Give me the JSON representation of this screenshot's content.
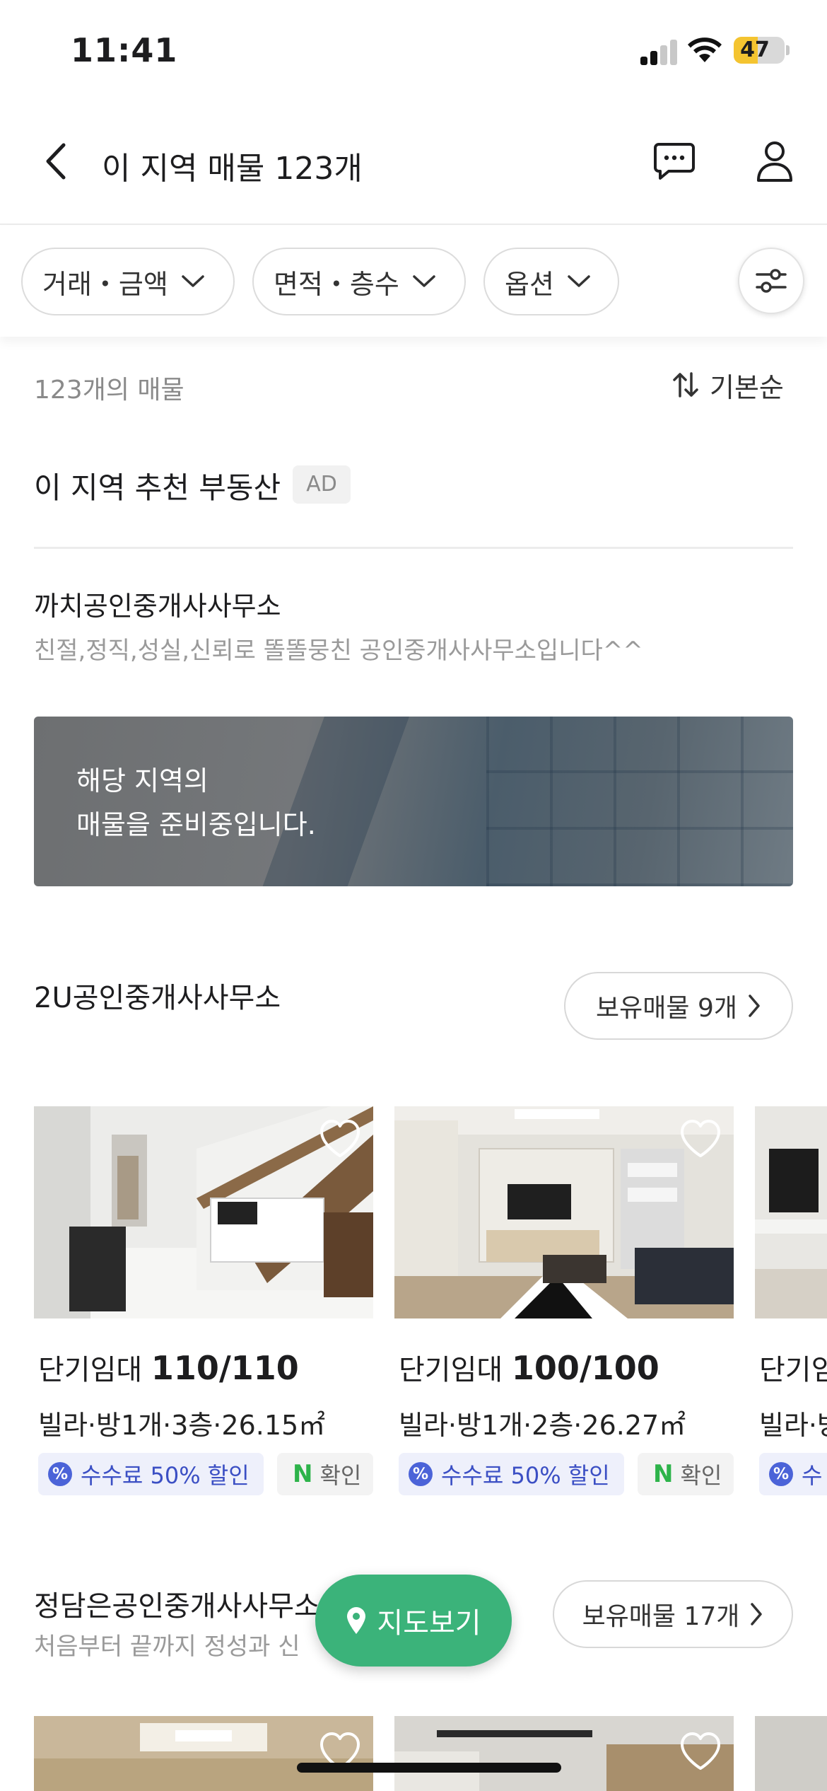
{
  "status_bar": {
    "time": "11:41",
    "battery": "47",
    "battery_level": 0.47
  },
  "header": {
    "title": "이 지역 매물 123개"
  },
  "filters": [
    {
      "label": "거래・금액"
    },
    {
      "label": "면적・층수"
    },
    {
      "label": "옵션"
    }
  ],
  "list": {
    "count_label": "123개의 매물",
    "sort_label": "기본순"
  },
  "recommend": {
    "title": "이 지역 추천 부동산",
    "ad_label": "AD"
  },
  "agency1": {
    "name": "까치공인중개사사무소",
    "desc": "친절,정직,성실,신뢰로 똘똘뭉친 공인중개사사무소입니다^^",
    "banner_line1": "해당 지역의",
    "banner_line2": "매물을 준비중입니다."
  },
  "agency2": {
    "name": "2U공인중개사사무소",
    "holdings_label": "보유매물 9개",
    "cards": [
      {
        "type": "단기임대",
        "price": "110/110",
        "info": "빌라·방1개·3층·26.15㎡",
        "discount": "수수료 50% 할인",
        "confirm": "확인"
      },
      {
        "type": "단기임대",
        "price": "100/100",
        "info": "빌라·방1개·2층·26.27㎡",
        "discount": "수수료 50% 할인",
        "confirm": "확인"
      },
      {
        "type": "단기임",
        "price": "",
        "info": "빌라·방",
        "discount": "수",
        "confirm": ""
      }
    ]
  },
  "agency3": {
    "name": "정담은공인중개사사무소",
    "desc": "처음부터 끝까지 정성과 신",
    "holdings_label": "보유매물 17개"
  },
  "map_button": {
    "label": "지도보기"
  },
  "colors": {
    "accent_green": "#3bb37a",
    "discount_blue": "#4b63d8",
    "naver_green": "#2db34a",
    "battery_yellow": "#f4c430"
  },
  "icons": [
    "back-arrow-icon",
    "chat-icon",
    "user-icon",
    "chevron-down-icon",
    "settings-sliders-icon",
    "sort-icon",
    "chevron-right-icon",
    "heart-icon",
    "percent-badge-icon",
    "map-pin-icon"
  ]
}
